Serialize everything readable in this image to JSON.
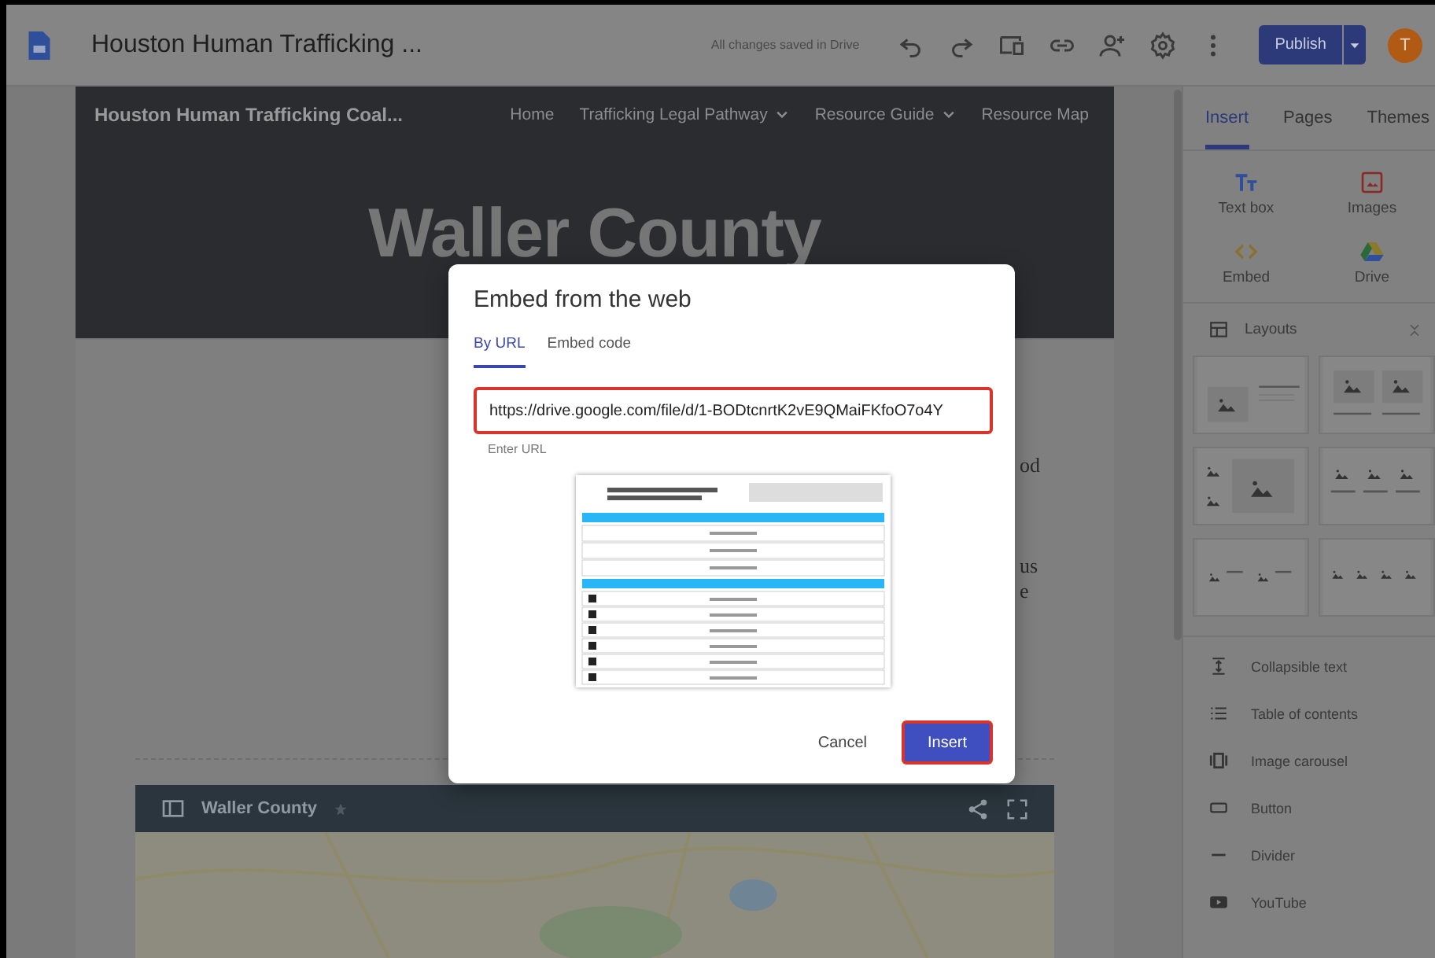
{
  "app_bar": {
    "document_title": "Houston Human Trafficking ...",
    "save_status": "All changes saved in Drive",
    "toolbar": [
      {
        "kind": "undo"
      },
      {
        "kind": "redo"
      },
      {
        "kind": "preview"
      },
      {
        "kind": "link"
      },
      {
        "kind": "share"
      },
      {
        "kind": "settings"
      },
      {
        "kind": "more"
      }
    ],
    "publish_button": "Publish",
    "avatar_letter": "T"
  },
  "site": {
    "site_title": "Houston Human Trafficking Coal...",
    "nav": [
      {
        "label": "Home",
        "has_menu": false
      },
      {
        "label": "Trafficking Legal Pathway",
        "has_menu": true
      },
      {
        "label": "Resource Guide",
        "has_menu": true
      },
      {
        "label": "Resource Map",
        "has_menu": false
      }
    ],
    "page_title": "Waller County",
    "text_fragments": [
      "od",
      "us",
      "e"
    ],
    "map_embed": {
      "title": "Waller County"
    }
  },
  "side_panel": {
    "tabs": [
      {
        "label": "Insert",
        "selected": true
      },
      {
        "label": "Pages",
        "selected": false
      },
      {
        "label": "Themes",
        "selected": false
      }
    ],
    "insert_items": [
      {
        "kind": "textbox",
        "label": "Text box"
      },
      {
        "kind": "images",
        "label": "Images"
      },
      {
        "kind": "embed",
        "label": "Embed"
      },
      {
        "kind": "drive",
        "label": "Drive"
      }
    ],
    "layouts": {
      "label": "Layouts",
      "expanded": true,
      "tiles": [
        {
          "kind": "image-text"
        },
        {
          "kind": "two-col"
        },
        {
          "kind": "image-stack"
        },
        {
          "kind": "three-col"
        },
        {
          "kind": "two-pairs"
        },
        {
          "kind": "four-col"
        }
      ]
    },
    "components": [
      {
        "kind": "collapsible",
        "label": "Collapsible text"
      },
      {
        "kind": "toc",
        "label": "Table of contents"
      },
      {
        "kind": "carousel",
        "label": "Image carousel"
      },
      {
        "kind": "button",
        "label": "Button"
      },
      {
        "kind": "divider",
        "label": "Divider"
      },
      {
        "kind": "youtube",
        "label": "YouTube"
      }
    ]
  },
  "dialog": {
    "title": "Embed from the web",
    "tabs": [
      {
        "label": "By URL",
        "selected": true
      },
      {
        "label": "Embed code",
        "selected": false
      }
    ],
    "url_field": {
      "value": "https://drive.google.com/file/d/1-BODtcnrtK2vE9QMaiFKfoO7o4Y",
      "highlighted": true
    },
    "field_hint": "Enter URL",
    "buttons": [
      {
        "label": "Cancel",
        "kind": "text",
        "highlighted": false
      },
      {
        "label": "Insert",
        "kind": "primary",
        "highlighted": true
      }
    ]
  }
}
